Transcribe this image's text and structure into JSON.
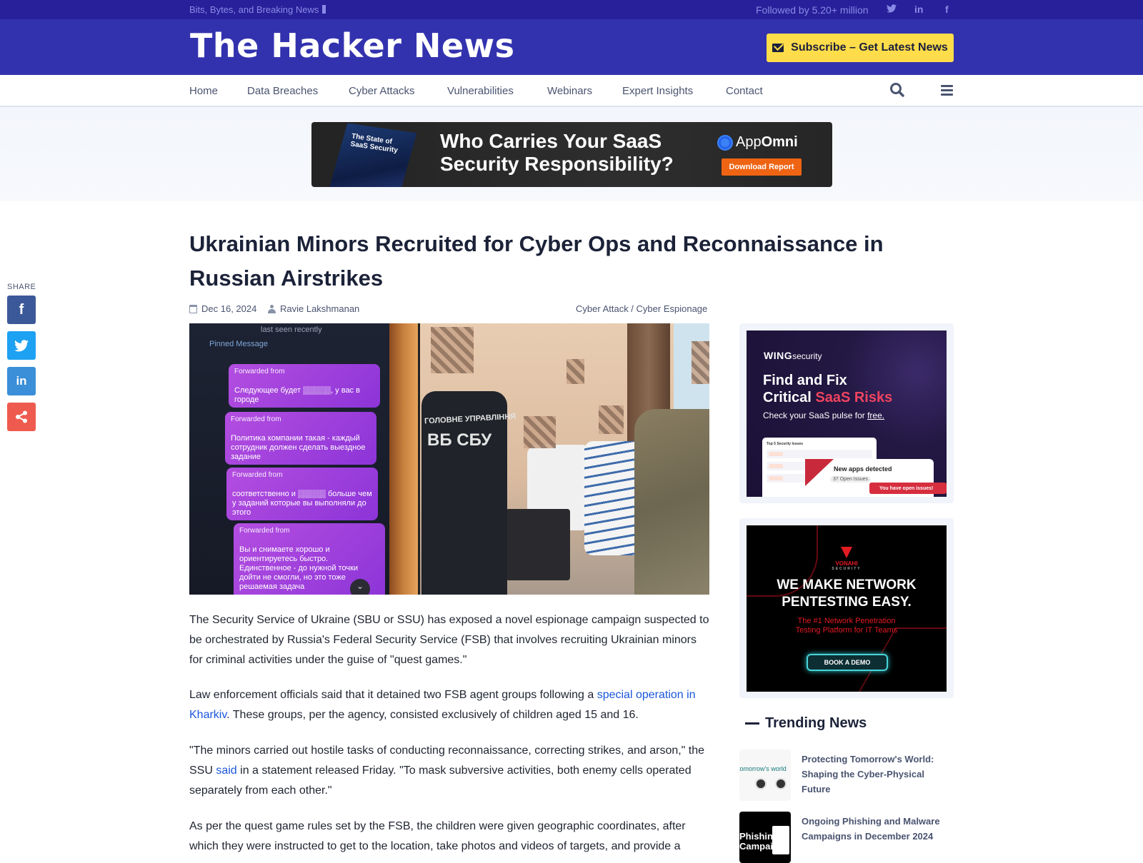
{
  "topbar": {
    "tagline": "Bits, Bytes, and Breaking News",
    "followed": "Followed by 5.20+ million",
    "social": [
      "twitter",
      "linkedin",
      "facebook"
    ]
  },
  "header": {
    "logo": "The Hacker News",
    "subscribe_label": "Subscribe – Get Latest News"
  },
  "nav": {
    "items": [
      "Home",
      "Data Breaches",
      "Cyber Attacks",
      "Vulnerabilities",
      "Webinars",
      "Expert Insights",
      "Contact"
    ]
  },
  "top_ad": {
    "book_title": "The State of SaaS Security",
    "headline_line1": "Who Carries Your SaaS",
    "headline_line2": "Security Responsibility?",
    "brand_prefix": "App",
    "brand_suffix": "Omni",
    "cta": "Download Report"
  },
  "share": {
    "label": "SHARE",
    "buttons": [
      {
        "name": "facebook",
        "glyph": "f",
        "color": "#3b5998"
      },
      {
        "name": "twitter",
        "glyph": "🐦",
        "color": "#1da1f2"
      },
      {
        "name": "linkedin",
        "glyph": "in",
        "color": "#3a8fd8"
      },
      {
        "name": "share",
        "glyph": "<",
        "color": "#ef5a4f"
      }
    ]
  },
  "article": {
    "title": "Ukrainian Minors Recruited for Cyber Ops and Reconnaissance in Russian Airstrikes",
    "date": "Dec 16, 2024",
    "author": "Ravie Lakshmanan",
    "categories": "Cyber Attack / Cyber Espionage",
    "image": {
      "phone_header": "last seen recently",
      "pinned": "Pinned Message",
      "messages": [
        {
          "from": "Forwarded from",
          "text": "Следующее будет ▒▒▒▒▒, у вас в городе"
        },
        {
          "from": "Forwarded from",
          "text": "Политика компании такая - каждый сотрудник должен сделать выездное задание"
        },
        {
          "from": "Forwarded from",
          "text": "соответственно и ▒▒▒▒▒ больше чем у заданий которые вы выполняли до этого"
        },
        {
          "from": "Forwarded from",
          "text": "Вы и снимаете хорошо и ориентируетесь быстро. Единственное - до нужной точки дойти не смогли, но это тоже решаемая задача"
        }
      ],
      "vest_line1": "ГОЛОВНЕ УПРАВЛІННЯ",
      "vest_line2": "ВБ СБУ"
    },
    "paragraphs": [
      {
        "parts": [
          {
            "text": "The Security Service of Ukraine (SBU or SSU) has exposed a novel espionage campaign suspected to be orchestrated by Russia's Federal Security Service (FSB) that involves recruiting Ukrainian minors for criminal activities under the guise of \"quest games.\""
          }
        ]
      },
      {
        "parts": [
          {
            "text": "Law enforcement officials said that it detained two FSB agent groups following a "
          },
          {
            "text": "special operation in Kharkiv",
            "link": true
          },
          {
            "text": ". These groups, per the agency, consisted exclusively of children aged 15 and 16."
          }
        ]
      },
      {
        "parts": [
          {
            "text": "\"The minors carried out hostile tasks of conducting reconnaissance, correcting strikes, and arson,\" the SSU "
          },
          {
            "text": "said",
            "link": true
          },
          {
            "text": " in a statement released Friday. \"To mask subversive activities, both enemy cells operated separately from each other.\""
          }
        ]
      },
      {
        "parts": [
          {
            "text": "As per the quest game rules set by the FSB, the children were given geographic coordinates, after which they were instructed to get to the location, take photos and videos of targets, and provide a"
          }
        ]
      }
    ]
  },
  "sidebar": {
    "wing_ad": {
      "brand_bold": "WING",
      "brand_light": "security",
      "headline_line1": "Find and Fix",
      "headline_line2_white": "Critical ",
      "headline_line2_red": "SaaS Risks",
      "sub_prefix": "Check your SaaS pulse for ",
      "sub_link": "free.",
      "panel_title": "Top 5 Security Issues",
      "alert_title": "New apps detected",
      "alert_count": "37 Open Issues",
      "pill": "You have open issues!"
    },
    "vonahi_ad": {
      "brand": "VONAHI",
      "brand_sub": "SECURITY",
      "headline_line1": "WE MAKE NETWORK",
      "headline_line2": "PENTESTING EASY.",
      "sub_line1": "The #1 Network Penetration",
      "sub_line2": "Testing Platform for IT Teams",
      "cta": "BOOK A DEMO"
    },
    "trending": {
      "heading": "Trending News",
      "items": [
        {
          "title": "Protecting Tomorrow's World: Shaping the Cyber-Physical Future",
          "thumb_text": "tomorrow's world"
        },
        {
          "title": "Ongoing Phishing and Malware Campaigns in December 2024",
          "thumb_text": "Phishing Campaigns"
        }
      ]
    }
  }
}
